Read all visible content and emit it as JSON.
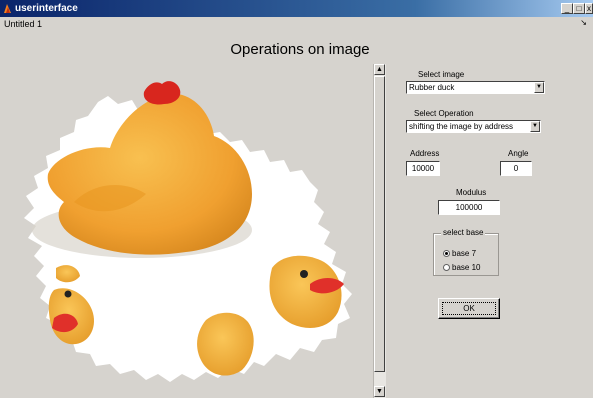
{
  "window": {
    "title": "userinterface",
    "controls": {
      "minimize": "_",
      "maximize": "□",
      "close": "x"
    }
  },
  "menubar": {
    "figure_name": "Untitled 1",
    "arrow": "↘"
  },
  "figure": {
    "title": "Operations on image"
  },
  "scrollbar": {
    "up_arrow": "▲",
    "down_arrow": "▼"
  },
  "controls": {
    "select_image": {
      "label": "Select image",
      "value": "Rubber duck",
      "arrow": "▼"
    },
    "select_operation": {
      "label": "Select Operation",
      "value": "shifting the image by address",
      "arrow": "▼"
    },
    "address": {
      "label": "Address",
      "value": "10000"
    },
    "angle": {
      "label": "Angle",
      "value": "0"
    },
    "modulus": {
      "label": "Modulus",
      "value": "100000"
    },
    "select_base": {
      "title": "select base",
      "options": [
        {
          "label": "base 7",
          "selected": true
        },
        {
          "label": "base 10",
          "selected": false
        }
      ]
    },
    "ok_button": {
      "label": "OK"
    }
  },
  "image": {
    "subject": "rubber duck image fragments on a hexagonal-tiled white region",
    "duck_color": "#f2a93a",
    "beak_color": "#e0302a"
  },
  "colors": {
    "window_background": "#d6d3ce",
    "titlebar_start": "#0a246a",
    "titlebar_end": "#a6caf0"
  }
}
